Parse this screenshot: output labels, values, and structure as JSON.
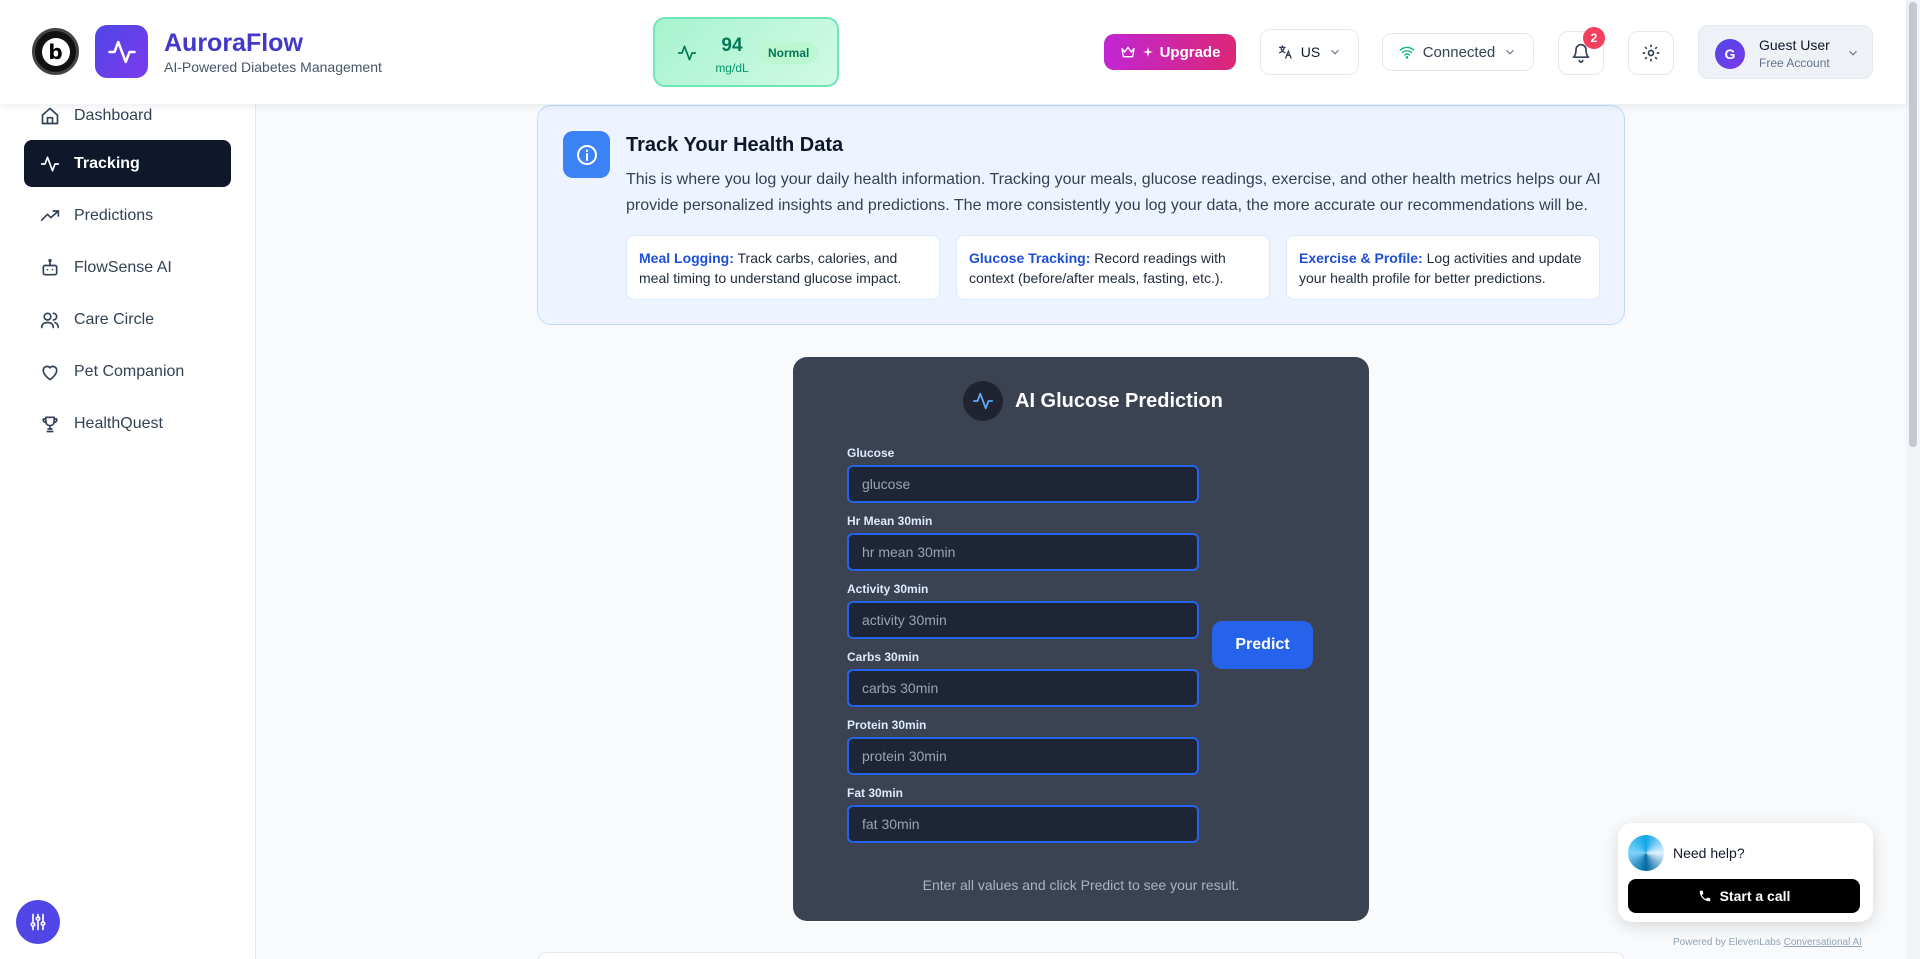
{
  "header": {
    "badge_letter": "b",
    "brand_title": "AuroraFlow",
    "brand_subtitle": "AI-Powered Diabetes Management",
    "glucose": {
      "value": "94",
      "unit": "mg/dL",
      "status": "Normal"
    },
    "upgrade_label": "Upgrade",
    "language_label": "US",
    "connection_label": "Connected",
    "notification_count": "2",
    "user": {
      "initial": "G",
      "name": "Guest User",
      "plan": "Free Account"
    }
  },
  "sidebar": {
    "items": [
      {
        "label": "Dashboard",
        "icon": "home-icon",
        "active": false
      },
      {
        "label": "Tracking",
        "icon": "activity-icon",
        "active": true
      },
      {
        "label": "Predictions",
        "icon": "trending-up-icon",
        "active": false
      },
      {
        "label": "FlowSense AI",
        "icon": "robot-icon",
        "active": false
      },
      {
        "label": "Care Circle",
        "icon": "users-icon",
        "active": false
      },
      {
        "label": "Pet Companion",
        "icon": "heart-icon",
        "active": false
      },
      {
        "label": "HealthQuest",
        "icon": "trophy-icon",
        "active": false
      }
    ]
  },
  "info": {
    "title": "Track Your Health Data",
    "description": "This is where you log your daily health information. Tracking your meals, glucose readings, exercise, and other health metrics helps our AI provide personalized insights and predictions. The more consistently you log your data, the more accurate our recommendations will be.",
    "features": [
      {
        "title": "Meal Logging:",
        "text": " Track carbs, calories, and meal timing to understand glucose impact."
      },
      {
        "title": "Glucose Tracking:",
        "text": " Record readings with context (before/after meals, fasting, etc.)."
      },
      {
        "title": "Exercise & Profile:",
        "text": " Log activities and update your health profile for better predictions."
      }
    ]
  },
  "prediction": {
    "title": "AI Glucose Prediction",
    "fields": [
      {
        "label": "Glucose",
        "placeholder": "glucose"
      },
      {
        "label": "Hr Mean 30min",
        "placeholder": "hr mean 30min"
      },
      {
        "label": "Activity 30min",
        "placeholder": "activity 30min"
      },
      {
        "label": "Carbs 30min",
        "placeholder": "carbs 30min"
      },
      {
        "label": "Protein 30min",
        "placeholder": "protein 30min"
      },
      {
        "label": "Fat 30min",
        "placeholder": "fat 30min"
      }
    ],
    "predict_label": "Predict",
    "footer": "Enter all values and click Predict to see your result."
  },
  "help": {
    "title": "Need help?",
    "call_label": "Start a call",
    "powered_prefix": "Powered by ElevenLabs ",
    "powered_link": "Conversational AI"
  },
  "colors": {
    "brand": "#4f46e5",
    "active_nav": "#0f172a",
    "accent_blue": "#2563eb",
    "status_normal": "#047857",
    "upgrade": "#db2777"
  }
}
